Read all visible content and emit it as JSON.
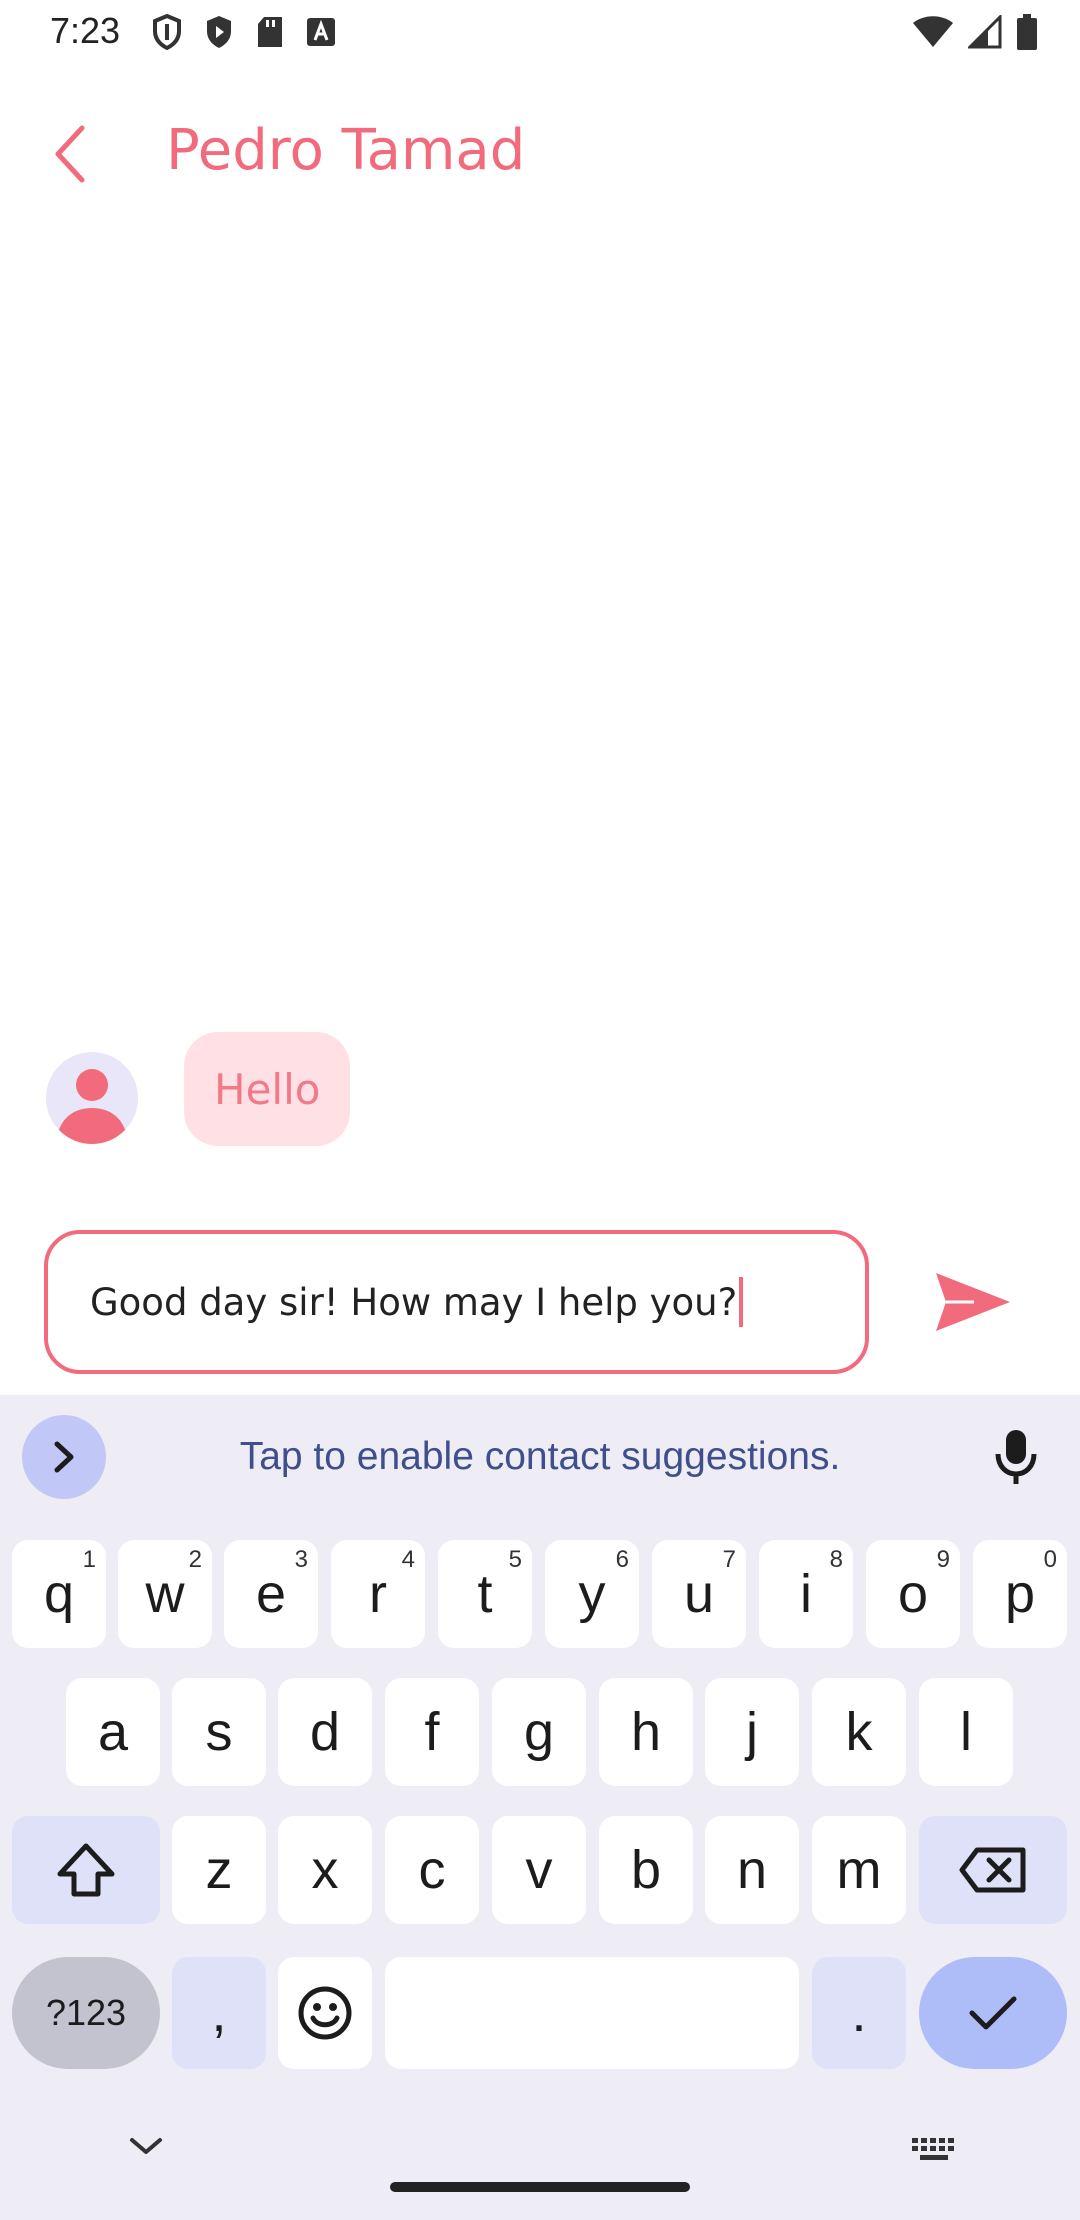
{
  "status_bar": {
    "time": "7:23"
  },
  "header": {
    "title": "Pedro Tamad"
  },
  "messages": [
    {
      "text": "Hello"
    }
  ],
  "composer": {
    "value": "Good day sir! How may I help you?"
  },
  "keyboard": {
    "suggestion_text": "Tap to enable contact suggestions.",
    "row1": [
      {
        "label": "q",
        "hint": "1"
      },
      {
        "label": "w",
        "hint": "2"
      },
      {
        "label": "e",
        "hint": "3"
      },
      {
        "label": "r",
        "hint": "4"
      },
      {
        "label": "t",
        "hint": "5"
      },
      {
        "label": "y",
        "hint": "6"
      },
      {
        "label": "u",
        "hint": "7"
      },
      {
        "label": "i",
        "hint": "8"
      },
      {
        "label": "o",
        "hint": "9"
      },
      {
        "label": "p",
        "hint": "0"
      }
    ],
    "row2": [
      "a",
      "s",
      "d",
      "f",
      "g",
      "h",
      "j",
      "k",
      "l"
    ],
    "row3": [
      "z",
      "x",
      "c",
      "v",
      "b",
      "n",
      "m"
    ],
    "symbols_label": "?123",
    "comma_label": ",",
    "period_label": "."
  },
  "colors": {
    "accent": "#f26b7c",
    "bubble_bg": "#ffe0e4",
    "keyboard_bg": "#eeedf5",
    "suggestion_text": "#3e4f8c"
  }
}
